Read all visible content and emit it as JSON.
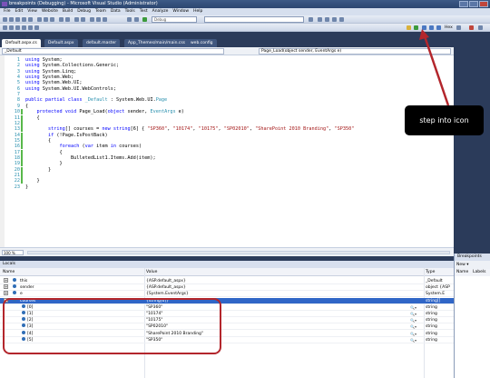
{
  "window": {
    "title": "breakpoints (Debugging) - Microsoft Visual Studio (Administrator)"
  },
  "menu": [
    "File",
    "Edit",
    "View",
    "Website",
    "Build",
    "Debug",
    "Team",
    "Data",
    "Tools",
    "Test",
    "Analyze",
    "Window",
    "Help"
  ],
  "toolbar": {
    "config": "Debug",
    "hex_label": "Hex"
  },
  "tabs": [
    "Default.aspx.cs",
    "Default.aspx",
    "default.master",
    "App_Themes/main/main.css",
    "web.config"
  ],
  "nav": {
    "class_combo": "_Default",
    "method_combo": "Page_Load(object sender, EventArgs e)"
  },
  "code": [
    {
      "n": "1",
      "t": [
        [
          "k",
          "using"
        ],
        [
          "p",
          " System;"
        ]
      ]
    },
    {
      "n": "2",
      "t": [
        [
          "k",
          "using"
        ],
        [
          "p",
          " System.Collections.Generic;"
        ]
      ]
    },
    {
      "n": "3",
      "t": [
        [
          "k",
          "using"
        ],
        [
          "p",
          " System.Linq;"
        ]
      ]
    },
    {
      "n": "4",
      "t": [
        [
          "k",
          "using"
        ],
        [
          "p",
          " System.Web;"
        ]
      ]
    },
    {
      "n": "5",
      "t": [
        [
          "k",
          "using"
        ],
        [
          "p",
          " System.Web.UI;"
        ]
      ]
    },
    {
      "n": "6",
      "t": [
        [
          "k",
          "using"
        ],
        [
          "p",
          " System.Web.UI.WebControls;"
        ]
      ]
    },
    {
      "n": "7",
      "t": []
    },
    {
      "n": "8",
      "t": [
        [
          "k",
          "public partial class"
        ],
        [
          "p",
          " "
        ],
        [
          "y",
          "_Default"
        ],
        [
          "p",
          " : System.Web.UI."
        ],
        [
          "y",
          "Page"
        ]
      ]
    },
    {
      "n": "9",
      "t": [
        [
          "p",
          "{"
        ]
      ]
    },
    {
      "n": "10",
      "t": [
        [
          "p",
          "    "
        ],
        [
          "k",
          "protected void"
        ],
        [
          "p",
          " Page_Load("
        ],
        [
          "k",
          "object"
        ],
        [
          "p",
          " sender, "
        ],
        [
          "y",
          "EventArgs"
        ],
        [
          "p",
          " e)"
        ]
      ]
    },
    {
      "n": "11",
      "t": [
        [
          "p",
          "    {"
        ]
      ]
    },
    {
      "n": "12",
      "t": []
    },
    {
      "n": "13",
      "t": [
        [
          "p",
          "        "
        ],
        [
          "k",
          "string"
        ],
        [
          "p",
          "[] courses = "
        ],
        [
          "k",
          "new string"
        ],
        [
          "p",
          "[6] { "
        ],
        [
          "s",
          "\"SP360\""
        ],
        [
          "p",
          ", "
        ],
        [
          "s",
          "\"10174\""
        ],
        [
          "p",
          ", "
        ],
        [
          "s",
          "\"10175\""
        ],
        [
          "p",
          ", "
        ],
        [
          "s",
          "\"SP02010\""
        ],
        [
          "p",
          ", "
        ],
        [
          "s",
          "\"SharePoint 2010 Branding\""
        ],
        [
          "p",
          ", "
        ],
        [
          "s",
          "\"SP350\""
        ]
      ]
    },
    {
      "n": "14",
      "t": [
        [
          "p",
          "        "
        ],
        [
          "k",
          "if"
        ],
        [
          "p",
          " (!Page.IsPostBack)"
        ]
      ]
    },
    {
      "n": "15",
      "t": [
        [
          "p",
          "        {"
        ]
      ]
    },
    {
      "n": "16",
      "t": [
        [
          "p",
          "            "
        ],
        [
          "k",
          "foreach"
        ],
        [
          "p",
          " ("
        ],
        [
          "k",
          "var"
        ],
        [
          "p",
          " item "
        ],
        [
          "k",
          "in"
        ],
        [
          "p",
          " courses)"
        ]
      ]
    },
    {
      "n": "17",
      "t": [
        [
          "p",
          "            {"
        ]
      ]
    },
    {
      "n": "18",
      "t": [
        [
          "p",
          "                BulletedList1.Items.Add(item);"
        ]
      ]
    },
    {
      "n": "19",
      "t": [
        [
          "p",
          "            }"
        ]
      ]
    },
    {
      "n": "20",
      "t": [
        [
          "p",
          "        }"
        ]
      ]
    },
    {
      "n": "21",
      "t": []
    },
    {
      "n": "22",
      "t": [
        [
          "p",
          "    }"
        ]
      ]
    },
    {
      "n": "23",
      "t": [
        [
          "p",
          "}"
        ]
      ]
    }
  ],
  "zoom": "100 %",
  "locals": {
    "title": "Locals",
    "headers": {
      "name": "Name",
      "value": "Value",
      "type": "Type"
    },
    "rows": [
      {
        "name": "this",
        "value": "{ASP.default_aspx}",
        "type": "_Default",
        "exp": "+",
        "child": false,
        "sel": false
      },
      {
        "name": "sender",
        "value": "{ASP.default_aspx}",
        "type": "object {ASP",
        "exp": "+",
        "child": false,
        "sel": false
      },
      {
        "name": "e",
        "value": "{System.EventArgs}",
        "type": "System.E",
        "exp": "+",
        "child": false,
        "sel": false
      },
      {
        "name": "courses",
        "value": "{string[6]}",
        "type": "string[]",
        "exp": "-",
        "child": false,
        "sel": true
      },
      {
        "name": "[0]",
        "value": "\"SP360\"",
        "type": "string",
        "exp": "",
        "child": true,
        "sel": false
      },
      {
        "name": "[1]",
        "value": "\"10174\"",
        "type": "string",
        "exp": "",
        "child": true,
        "sel": false
      },
      {
        "name": "[2]",
        "value": "\"10175\"",
        "type": "string",
        "exp": "",
        "child": true,
        "sel": false
      },
      {
        "name": "[3]",
        "value": "\"SP02010\"",
        "type": "string",
        "exp": "",
        "child": true,
        "sel": false
      },
      {
        "name": "[4]",
        "value": "\"SharePoint 2010 Branding\"",
        "type": "string",
        "exp": "",
        "child": true,
        "sel": false
      },
      {
        "name": "[5]",
        "value": "\"SP350\"",
        "type": "string",
        "exp": "",
        "child": true,
        "sel": false
      }
    ]
  },
  "breakpoints": {
    "title": "Breakpoints",
    "new_label": "New ▾",
    "col_name": "Name",
    "col_labels": "Labels"
  },
  "callout": {
    "text": "step into icon"
  },
  "colors": {
    "callout_bg": "#000000",
    "highlight": "#b3262c",
    "selected_row": "#3066c7"
  }
}
